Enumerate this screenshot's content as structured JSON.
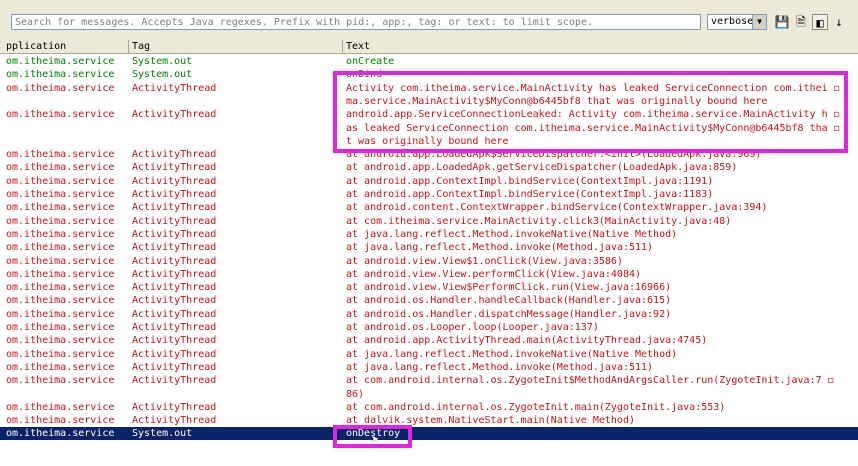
{
  "toolbar": {
    "search_placeholder": "Search for messages. Accepts Java regexes. Prefix with pid:, app:, tag: or text: to limit scope.",
    "level": "verbose",
    "save_icon": "💾",
    "clear_icon": "🗎",
    "toggle_icon": "◧",
    "scroll_icon": "↓"
  },
  "columns": [
    "pplication",
    "Tag",
    "Text"
  ],
  "colors": {
    "info": "#008000",
    "error": "#c81414",
    "selected": "#0a246a",
    "highlight": "#e026e0"
  },
  "rows": [
    {
      "app": "om.itheima.service",
      "tag": "System.out",
      "text": "onCreate",
      "level": "info"
    },
    {
      "app": "om.itheima.service",
      "tag": "System.out",
      "text": "onBind",
      "level": "info"
    },
    {
      "app": "om.itheima.service",
      "tag": "ActivityThread",
      "text": "Activity com.itheima.service.MainActivity has leaked ServiceConnection com.ithei ◻",
      "level": "error"
    },
    {
      "app": "",
      "tag": "",
      "text": "ma.service.MainActivity$MyConn@b6445bf8 that was originally bound here",
      "level": "error"
    },
    {
      "app": "om.itheima.service",
      "tag": "ActivityThread",
      "text": "android.app.ServiceConnectionLeaked: Activity com.itheima.service.MainActivity h ◻",
      "level": "error"
    },
    {
      "app": "",
      "tag": "",
      "text": "as leaked ServiceConnection com.itheima.service.MainActivity$MyConn@b6445bf8 tha ◻",
      "level": "error"
    },
    {
      "app": "",
      "tag": "",
      "text": "t was originally bound here",
      "level": "error"
    },
    {
      "app": "om.itheima.service",
      "tag": "ActivityThread",
      "text": "at android.app.LoadedApk$ServiceDispatcher.<init>(LoadedApk.java:969)",
      "level": "error"
    },
    {
      "app": "om.itheima.service",
      "tag": "ActivityThread",
      "text": "at android.app.LoadedApk.getServiceDispatcher(LoadedApk.java:859)",
      "level": "error"
    },
    {
      "app": "om.itheima.service",
      "tag": "ActivityThread",
      "text": "at android.app.ContextImpl.bindService(ContextImpl.java:1191)",
      "level": "error"
    },
    {
      "app": "om.itheima.service",
      "tag": "ActivityThread",
      "text": "at android.app.ContextImpl.bindService(ContextImpl.java:1183)",
      "level": "error"
    },
    {
      "app": "om.itheima.service",
      "tag": "ActivityThread",
      "text": "at android.content.ContextWrapper.bindService(ContextWrapper.java:394)",
      "level": "error"
    },
    {
      "app": "om.itheima.service",
      "tag": "ActivityThread",
      "text": "at com.itheima.service.MainActivity.click3(MainActivity.java:48)",
      "level": "error"
    },
    {
      "app": "om.itheima.service",
      "tag": "ActivityThread",
      "text": "at java.lang.reflect.Method.invokeNative(Native Method)",
      "level": "error"
    },
    {
      "app": "om.itheima.service",
      "tag": "ActivityThread",
      "text": "at java.lang.reflect.Method.invoke(Method.java:511)",
      "level": "error"
    },
    {
      "app": "om.itheima.service",
      "tag": "ActivityThread",
      "text": "at android.view.View$1.onClick(View.java:3586)",
      "level": "error"
    },
    {
      "app": "om.itheima.service",
      "tag": "ActivityThread",
      "text": "at android.view.View.performClick(View.java:4084)",
      "level": "error"
    },
    {
      "app": "om.itheima.service",
      "tag": "ActivityThread",
      "text": "at android.view.View$PerformClick.run(View.java:16966)",
      "level": "error"
    },
    {
      "app": "om.itheima.service",
      "tag": "ActivityThread",
      "text": "at android.os.Handler.handleCallback(Handler.java:615)",
      "level": "error"
    },
    {
      "app": "om.itheima.service",
      "tag": "ActivityThread",
      "text": "at android.os.Handler.dispatchMessage(Handler.java:92)",
      "level": "error"
    },
    {
      "app": "om.itheima.service",
      "tag": "ActivityThread",
      "text": "at android.os.Looper.loop(Looper.java:137)",
      "level": "error"
    },
    {
      "app": "om.itheima.service",
      "tag": "ActivityThread",
      "text": "at android.app.ActivityThread.main(ActivityThread.java:4745)",
      "level": "error"
    },
    {
      "app": "om.itheima.service",
      "tag": "ActivityThread",
      "text": "at java.lang.reflect.Method.invokeNative(Native Method)",
      "level": "error"
    },
    {
      "app": "om.itheima.service",
      "tag": "ActivityThread",
      "text": "at java.lang.reflect.Method.invoke(Method.java:511)",
      "level": "error"
    },
    {
      "app": "om.itheima.service",
      "tag": "ActivityThread",
      "text": "at com.android.internal.os.ZygoteInit$MethodAndArgsCaller.run(ZygoteInit.java:7 ◻",
      "level": "error"
    },
    {
      "app": "",
      "tag": "",
      "text": "86)",
      "level": "error"
    },
    {
      "app": "om.itheima.service",
      "tag": "ActivityThread",
      "text": "at com.android.internal.os.ZygoteInit.main(ZygoteInit.java:553)",
      "level": "error"
    },
    {
      "app": "om.itheima.service",
      "tag": "ActivityThread",
      "text": "at dalvik.system.NativeStart.main(Native Method)",
      "level": "error"
    },
    {
      "app": "om.itheima.service",
      "tag": "System.out",
      "text": "onDestroy",
      "level": "selected"
    }
  ]
}
